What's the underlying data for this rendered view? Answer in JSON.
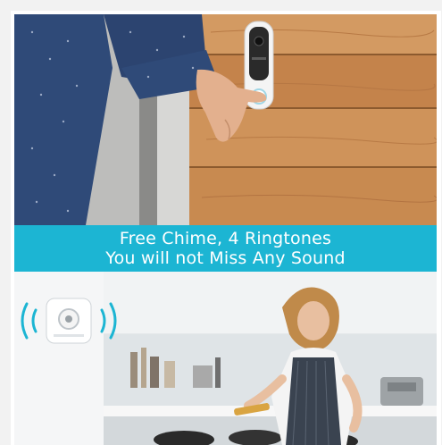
{
  "banner": {
    "line1": "Free Chime, 4 Ringtones",
    "line2": "You will not Miss Any Sound"
  },
  "scene_top": {
    "subject": "doorbell-press",
    "colors": {
      "wood": "#c98a52",
      "sleeve": "#2f4a78",
      "doorbell": "#f4f4f4"
    }
  },
  "scene_bottom": {
    "subject": "woman-cooking-with-chime",
    "colors": {
      "kitchen": "#e9edf0",
      "apron": "#3a4350",
      "chime": "#ffffff",
      "signal": "#1cb5d3"
    }
  }
}
